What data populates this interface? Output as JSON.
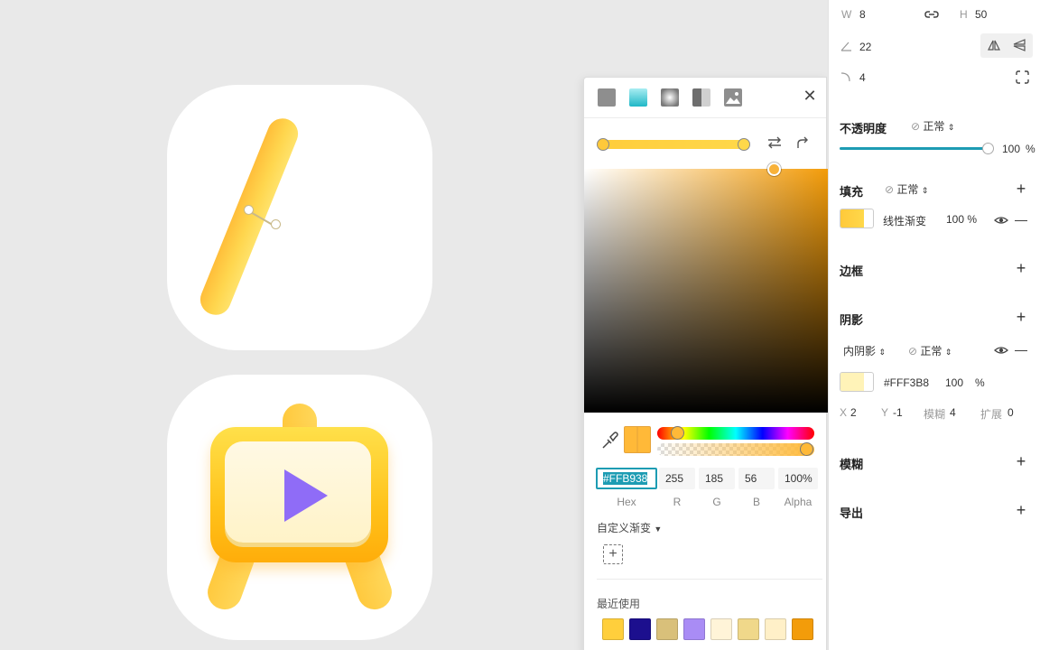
{
  "picker": {
    "hex_value": "#FFB938",
    "r_value": "255",
    "g_value": "185",
    "b_value": "56",
    "alpha_value": "100%",
    "hex_label": "Hex",
    "r_label": "R",
    "g_label": "G",
    "b_label": "B",
    "alpha_label": "Alpha",
    "custom_gradient_label": "自定义渐变",
    "recent_label": "最近使用",
    "recent_colors": [
      "#ffcf3c",
      "#1c0f8e",
      "#d9c07a",
      "#a98cf5",
      "#fff4d8",
      "#f0d88a",
      "#fff0c8",
      "#f39c0a"
    ],
    "fill_modes": [
      "solid",
      "linear-gradient",
      "radial-gradient",
      "angular-gradient",
      "image"
    ],
    "current_color": "#FFB938"
  },
  "inspector": {
    "w_label": "W",
    "w_value": "8",
    "h_label": "H",
    "h_value": "50",
    "rotation_value": "22",
    "radius_value": "4",
    "opacity_title": "不透明度",
    "opacity_blend": "正常",
    "opacity_value": "100",
    "opacity_unit": "%",
    "opacity_level": 1.0,
    "fill_title": "填充",
    "fill_blend": "正常",
    "fill_type": "线性渐变",
    "fill_opacity": "100 %",
    "border_title": "边框",
    "shadow_title": "阴影",
    "shadow_type": "内阴影",
    "shadow_blend": "正常",
    "shadow_color": "#FFF3B8",
    "shadow_opacity": "100",
    "shadow_unit": "%",
    "shadow_x_label": "X",
    "shadow_x": "2",
    "shadow_y_label": "Y",
    "shadow_y": "-1",
    "shadow_blur_label": "模糊",
    "shadow_blur": "4",
    "shadow_spread_label": "扩展",
    "shadow_spread": "0",
    "blur_title": "模糊",
    "export_title": "导出"
  },
  "colors": {
    "accent": "#1d9cb3",
    "icon_yellow": "#ffd64e",
    "play_purple": "#8f6cf7"
  }
}
